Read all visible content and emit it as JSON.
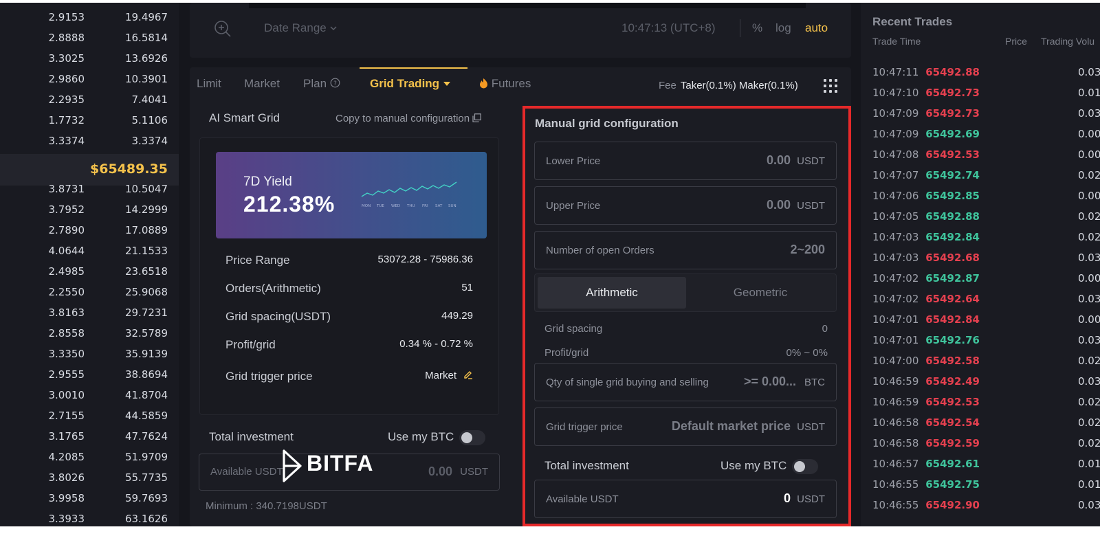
{
  "orderbook": {
    "asks": [
      {
        "amount": "2.9153",
        "total": "19.4967"
      },
      {
        "amount": "2.8888",
        "total": "16.5814"
      },
      {
        "amount": "3.3025",
        "total": "13.6926"
      },
      {
        "amount": "2.9860",
        "total": "10.3901"
      },
      {
        "amount": "2.2935",
        "total": "7.4041"
      },
      {
        "amount": "1.7732",
        "total": "5.1106"
      },
      {
        "amount": "3.3374",
        "total": "3.3374"
      }
    ],
    "mid_price": "$65489.35",
    "bids": [
      {
        "amount": "3.8731",
        "total": "10.5047"
      },
      {
        "amount": "3.7952",
        "total": "14.2999"
      },
      {
        "amount": "2.7890",
        "total": "17.0889"
      },
      {
        "amount": "4.0644",
        "total": "21.1533"
      },
      {
        "amount": "2.4985",
        "total": "23.6518"
      },
      {
        "amount": "2.2550",
        "total": "25.9068"
      },
      {
        "amount": "3.8163",
        "total": "29.7231"
      },
      {
        "amount": "2.8558",
        "total": "32.5789"
      },
      {
        "amount": "3.3350",
        "total": "35.9139"
      },
      {
        "amount": "2.9555",
        "total": "38.8694"
      },
      {
        "amount": "3.0010",
        "total": "41.8704"
      },
      {
        "amount": "2.7155",
        "total": "44.5859"
      },
      {
        "amount": "3.1765",
        "total": "47.7624"
      },
      {
        "amount": "4.2085",
        "total": "51.9709"
      },
      {
        "amount": "3.8026",
        "total": "55.7735"
      },
      {
        "amount": "3.9958",
        "total": "59.7693"
      },
      {
        "amount": "3.3933",
        "total": "63.1626"
      }
    ]
  },
  "chart_toolbar": {
    "date_range": "Date Range",
    "time": "10:47:13 (UTC+8)",
    "percent": "%",
    "log": "log",
    "auto": "auto"
  },
  "tabs": {
    "limit": "Limit",
    "market": "Market",
    "plan": "Plan",
    "grid_trading": "Grid Trading",
    "futures": "Futures"
  },
  "fee": {
    "label": "Fee",
    "value": "Taker(0.1%) Maker(0.1%)"
  },
  "ai_grid": {
    "title": "AI Smart Grid",
    "copy_label": "Copy to manual configuration",
    "yield_label": "7D Yield",
    "yield_value": "212.38%",
    "days": [
      "MON",
      "TUE",
      "WED",
      "THU",
      "FRI",
      "SAT",
      "SUN"
    ],
    "price_range_label": "Price Range",
    "price_range_value": "53072.28 - 75986.36",
    "orders_label": "Orders(Arithmetic)",
    "orders_value": "51",
    "spacing_label": "Grid spacing(USDT)",
    "spacing_value": "449.29",
    "profit_label": "Profit/grid",
    "profit_value": "0.34 % - 0.72 %",
    "trigger_label": "Grid trigger price",
    "trigger_value": "Market",
    "total_investment": "Total investment",
    "use_btc": "Use my BTC",
    "available_label": "Available USDT",
    "available_value": "0.00",
    "available_unit": "USDT",
    "minimum": "Minimum : 340.7198USDT"
  },
  "watermark": {
    "text": "BITFA"
  },
  "manual": {
    "title": "Manual grid configuration",
    "lower_label": "Lower Price",
    "lower_value": "0.00",
    "lower_unit": "USDT",
    "upper_label": "Upper Price",
    "upper_value": "0.00",
    "upper_unit": "USDT",
    "orders_label": "Number of open Orders",
    "orders_value": "2~200",
    "arithmetic": "Arithmetic",
    "geometric": "Geometric",
    "spacing_label": "Grid spacing",
    "spacing_value": "0",
    "profit_label": "Profit/grid",
    "profit_value": "0% ~ 0%",
    "qty_label": "Qty of single grid buying and selling",
    "qty_value": ">= 0.00...",
    "qty_unit": "BTC",
    "trigger_label": "Grid trigger price",
    "trigger_value": "Default market price",
    "trigger_unit": "USDT",
    "total_investment": "Total investment",
    "use_btc": "Use my BTC",
    "available_label": "Available USDT",
    "available_value": "0",
    "available_unit": "USDT"
  },
  "recent_trades": {
    "title": "Recent Trades",
    "headers": {
      "time": "Trade Time",
      "price": "Price",
      "volume": "Trading Volu"
    },
    "rows": [
      {
        "time": "10:47:11",
        "price": "65492.88",
        "qty": "0.03",
        "side": "down"
      },
      {
        "time": "10:47:10",
        "price": "65492.73",
        "qty": "0.01",
        "side": "down"
      },
      {
        "time": "10:47:09",
        "price": "65492.73",
        "qty": "0.03",
        "side": "down"
      },
      {
        "time": "10:47:09",
        "price": "65492.69",
        "qty": "0.00",
        "side": "up"
      },
      {
        "time": "10:47:08",
        "price": "65492.53",
        "qty": "0.00",
        "side": "down"
      },
      {
        "time": "10:47:07",
        "price": "65492.74",
        "qty": "0.02",
        "side": "up"
      },
      {
        "time": "10:47:06",
        "price": "65492.85",
        "qty": "0.00",
        "side": "up"
      },
      {
        "time": "10:47:05",
        "price": "65492.88",
        "qty": "0.02",
        "side": "up"
      },
      {
        "time": "10:47:03",
        "price": "65492.84",
        "qty": "0.02",
        "side": "up"
      },
      {
        "time": "10:47:03",
        "price": "65492.68",
        "qty": "0.03",
        "side": "down"
      },
      {
        "time": "10:47:02",
        "price": "65492.87",
        "qty": "0.00",
        "side": "up"
      },
      {
        "time": "10:47:02",
        "price": "65492.64",
        "qty": "0.03",
        "side": "down"
      },
      {
        "time": "10:47:01",
        "price": "65492.84",
        "qty": "0.00",
        "side": "down"
      },
      {
        "time": "10:47:01",
        "price": "65492.76",
        "qty": "0.03",
        "side": "up"
      },
      {
        "time": "10:47:00",
        "price": "65492.58",
        "qty": "0.02",
        "side": "down"
      },
      {
        "time": "10:46:59",
        "price": "65492.49",
        "qty": "0.03",
        "side": "down"
      },
      {
        "time": "10:46:59",
        "price": "65492.53",
        "qty": "0.02",
        "side": "down"
      },
      {
        "time": "10:46:58",
        "price": "65492.54",
        "qty": "0.02",
        "side": "down"
      },
      {
        "time": "10:46:58",
        "price": "65492.59",
        "qty": "0.02",
        "side": "down"
      },
      {
        "time": "10:46:57",
        "price": "65492.61",
        "qty": "0.01",
        "side": "up"
      },
      {
        "time": "10:46:55",
        "price": "65492.75",
        "qty": "0.01",
        "side": "up"
      },
      {
        "time": "10:46:55",
        "price": "65492.90",
        "qty": "0.03",
        "side": "down"
      }
    ]
  },
  "colors": {
    "accent": "#f5c24b",
    "up": "#3fc49c",
    "down": "#e5404f",
    "highlight_border": "#e5292a",
    "background": "#15161c"
  },
  "icons": [
    "zoom-in-icon",
    "chevron-down-icon",
    "question-circle-icon",
    "caret-down-icon",
    "flame-icon",
    "apps-grid-icon",
    "copy-icon",
    "pencil-icon",
    "sparkline-icon",
    "bitfa-logo-icon"
  ]
}
